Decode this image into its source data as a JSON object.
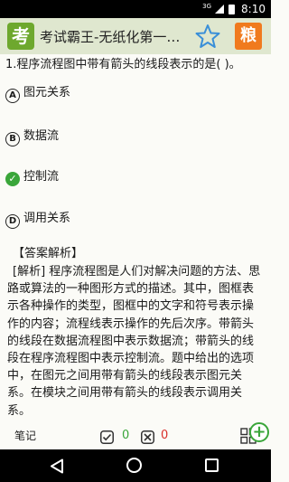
{
  "status_bar": {
    "network": "3G",
    "time": "8:10"
  },
  "app_bar": {
    "icon_char": "考",
    "title": "考试霸王-无纸化第一…",
    "star_icon": "star-outline-icon",
    "ad_char": "粮"
  },
  "question": {
    "text": "1.程序流程图中带有箭头的线段表示的是( )。"
  },
  "options": [
    {
      "letter": "A",
      "label": "图元关系",
      "correct": false
    },
    {
      "letter": "B",
      "label": "数据流",
      "correct": false
    },
    {
      "letter": "C",
      "label": "控制流",
      "correct": true,
      "mark": "✓"
    },
    {
      "letter": "D",
      "label": "调用关系",
      "correct": false
    }
  ],
  "analysis": {
    "title": "【答案解析】",
    "body": "[解析] 程序流程图是人们对解决问题的方法、思路或算法的一种图形方式的描述。其中，图框表示各种操作的类型，图框中的文字和符号表示操作的内容；流程线表示操作的先后次序。带箭头的线段在数据流程图中表示数据流；带箭头的线段在程序流程图中表示控制流。题中给出的选项中，在图元之间用带有箭头的线段表示图元关系。在模块之间用带有箭头的线段表示调用关系。"
  },
  "bottom_bar": {
    "note_label": "笔记",
    "right_count": "0",
    "wrong_count": "0",
    "plus_label": "+"
  },
  "colors": {
    "accent_green": "#3aa63a",
    "wrong_red": "#d9302b",
    "app_bar_bg": "#dfe7cf"
  }
}
